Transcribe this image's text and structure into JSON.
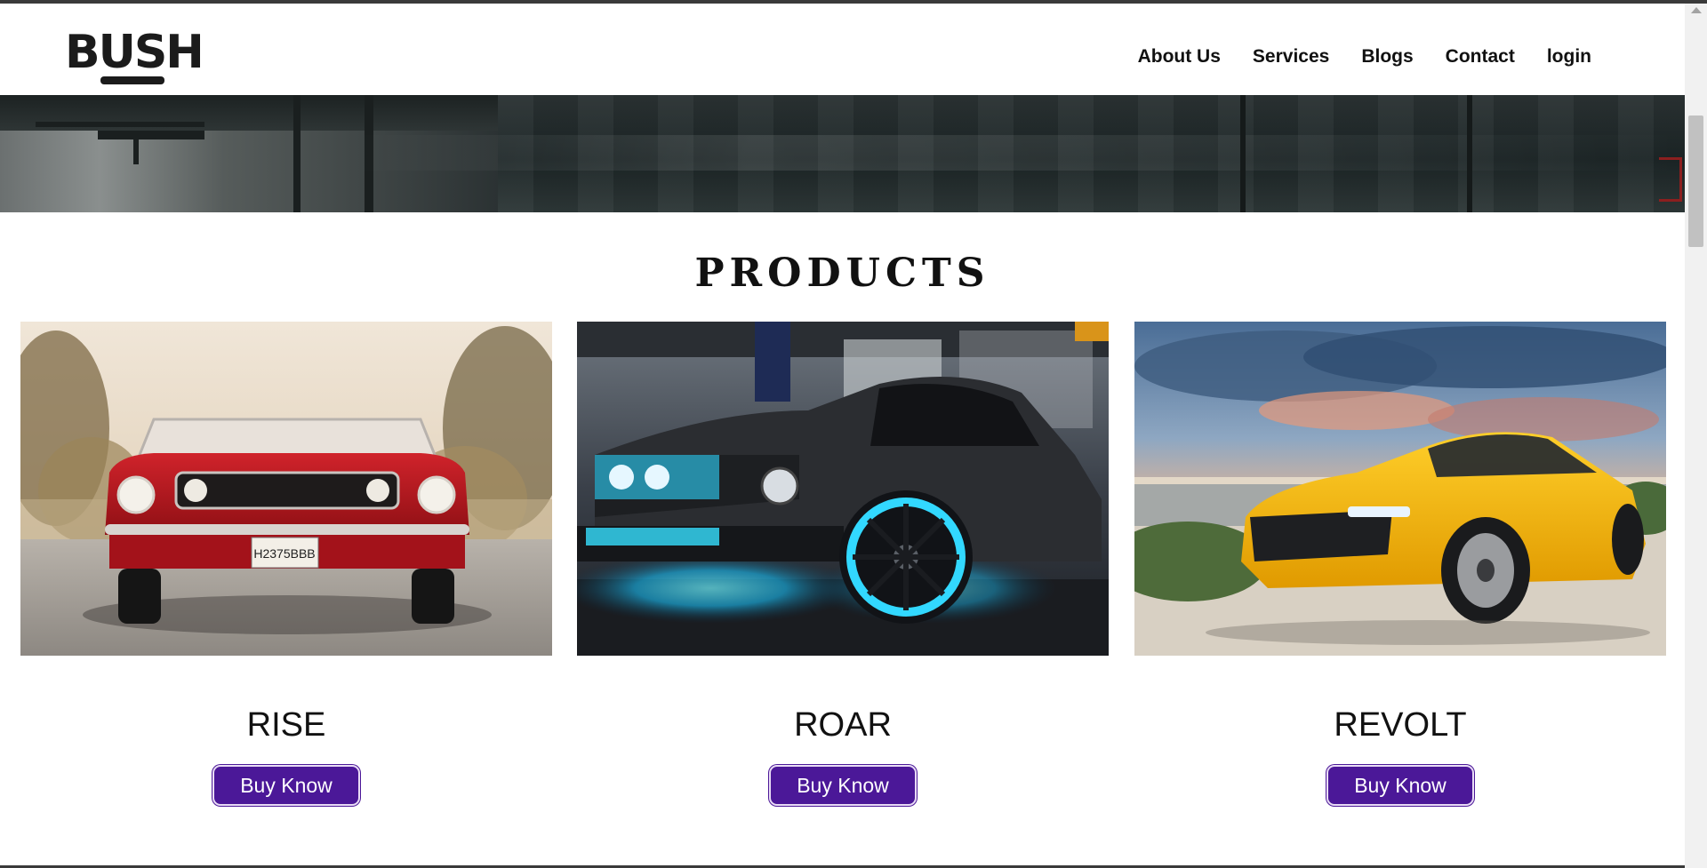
{
  "brand": {
    "logo_text": "BUSH"
  },
  "nav": {
    "items": [
      {
        "label": "About Us"
      },
      {
        "label": "Services"
      },
      {
        "label": "Blogs"
      },
      {
        "label": "Contact"
      },
      {
        "label": "login"
      }
    ]
  },
  "products": {
    "heading": "PRODUCTS",
    "items": [
      {
        "name": "RISE",
        "button_label": "Buy Know",
        "car_color": "#b3151b",
        "license": "H2375BBB"
      },
      {
        "name": "ROAR",
        "button_label": "Buy Know",
        "car_color": "#2a2c2e"
      },
      {
        "name": "REVOLT",
        "button_label": "Buy Know",
        "car_color": "#f2b410"
      }
    ]
  },
  "colors": {
    "button_bg": "#4b1898",
    "text": "#111111"
  }
}
